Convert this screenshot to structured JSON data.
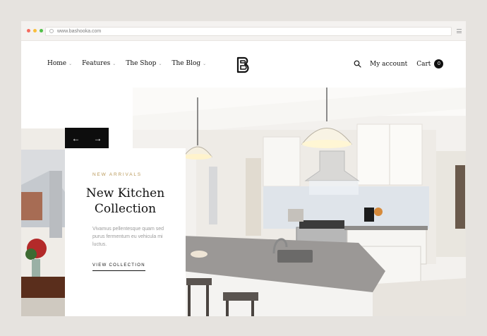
{
  "browser": {
    "url": "www.bashooka.com",
    "dot_colors": [
      "#f56b5f",
      "#f9be3c",
      "#52c04a"
    ]
  },
  "nav": {
    "items": [
      {
        "label": "Home",
        "has_dropdown": true
      },
      {
        "label": "Features",
        "has_dropdown": true
      },
      {
        "label": "The Shop",
        "has_dropdown": true
      },
      {
        "label": "The Blog",
        "has_dropdown": true
      }
    ],
    "dropdown_glyph": "⌄"
  },
  "header": {
    "account_label": "My account",
    "cart_label": "Cart",
    "cart_count": "0"
  },
  "hero": {
    "prev_glyph": "←",
    "next_glyph": "→",
    "eyebrow": "NEW ARRIVALS",
    "title_line1": "New Kitchen",
    "title_line2": "Collection",
    "description": "Vivamus pellentesque quam sed purus fermentum eu vehicula mi luctus.",
    "link_label": "VIEW COLLECTION"
  },
  "colors": {
    "accent": "#b89858",
    "dark": "#0d0d0d",
    "background": "#e6e3df"
  }
}
